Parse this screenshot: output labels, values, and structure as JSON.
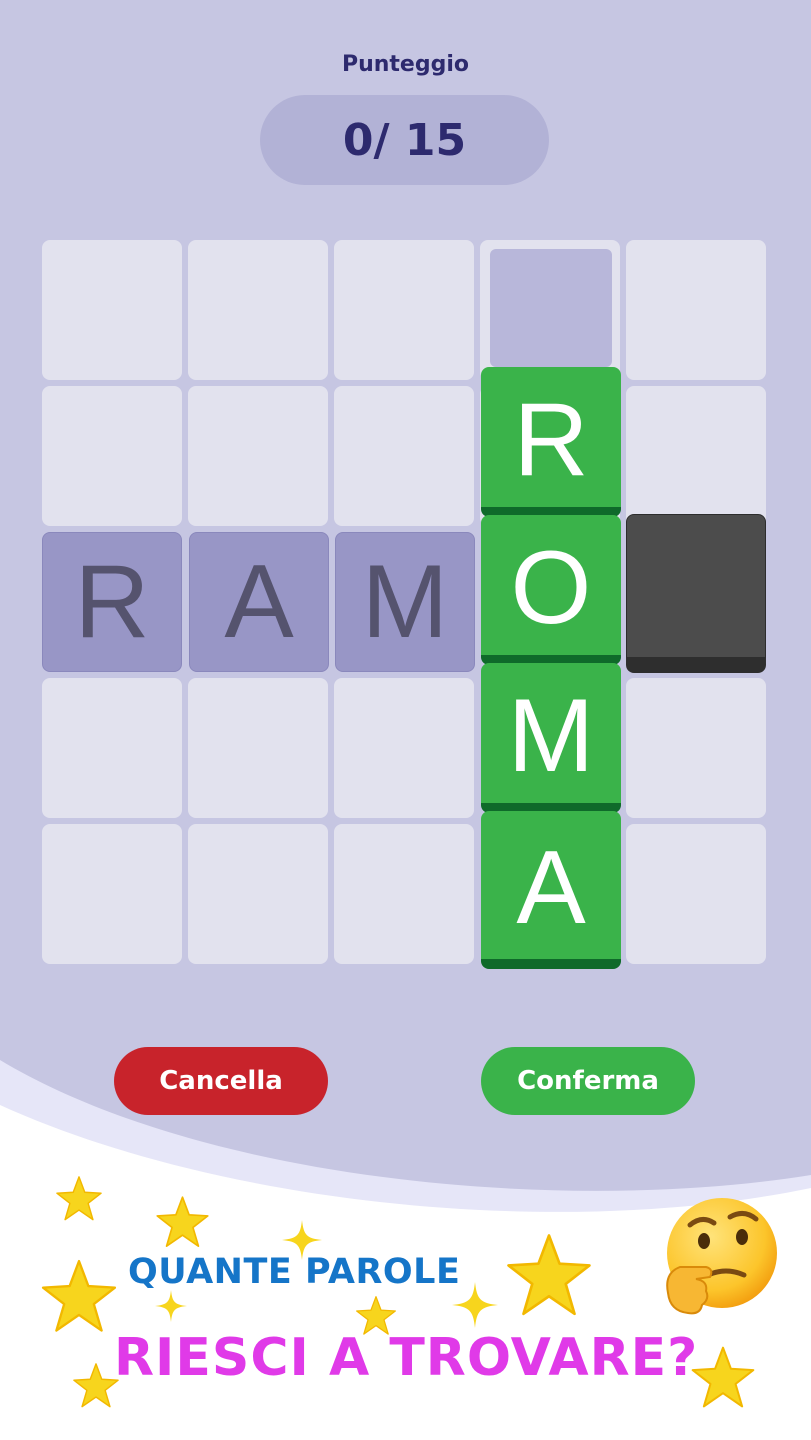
{
  "score": {
    "label": "Punteggio",
    "value": "0/ 15"
  },
  "grid": {
    "size": 5,
    "tiles": {
      "horizontal_word": [
        "R",
        "A",
        "M"
      ],
      "vertical_word": [
        "R",
        "O",
        "M",
        "A"
      ]
    }
  },
  "buttons": {
    "cancel": "Cancella",
    "confirm": "Conferma"
  },
  "promo": {
    "line1": "QUANTE PAROLE",
    "line2": "RIESCI A TROVARE?"
  },
  "icons": [
    "star-icon",
    "sparkle-icon",
    "thinking-face-icon"
  ],
  "colors": {
    "background": "#c6c6e2",
    "empty_cell": "#e2e2ee",
    "selected_tile": "#9896c6",
    "word_tile": "#3ab34a",
    "blocked_tile": "#4c4c4c",
    "cancel": "#c8232b",
    "confirm": "#3ab34a",
    "promo_blue": "#1575c8",
    "promo_pink": "#e03ae8"
  }
}
